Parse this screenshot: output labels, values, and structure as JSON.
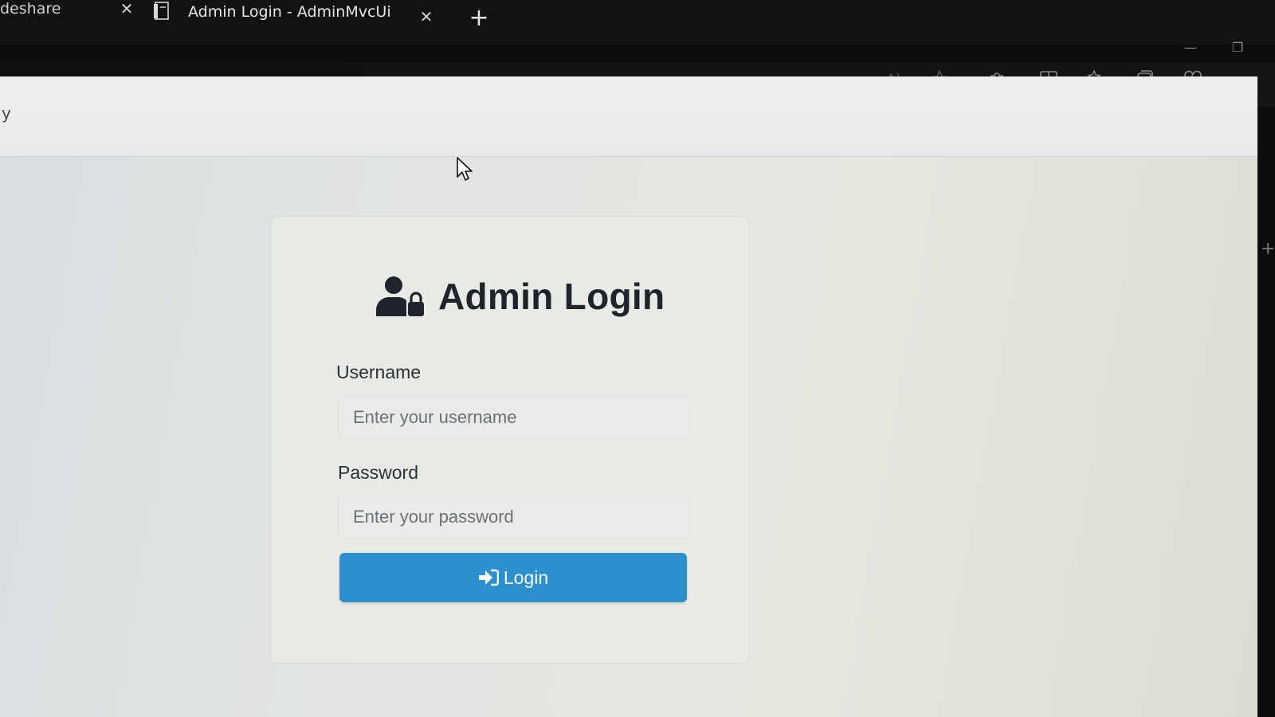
{
  "browser": {
    "tabs": [
      {
        "title": "deshare",
        "active": false
      },
      {
        "title": "Admin Login - AdminMvcUi",
        "active": true
      }
    ],
    "new_tab_symbol": "+",
    "close_symbol": "✕",
    "address_fragment": "y",
    "toolbar_icons": [
      "read-aloud-icon",
      "favorite-star-icon",
      "extensions-icon",
      "split-screen-icon",
      "favorites-list-icon",
      "collections-icon",
      "browser-essentials-icon",
      "more-menu-icon"
    ]
  },
  "login": {
    "title": "Admin Login",
    "heading_icon": "user-lock-icon",
    "username_label": "Username",
    "username_placeholder": "Enter your username",
    "password_label": "Password",
    "password_placeholder": "Enter your password",
    "button_label": "Login",
    "button_icon": "sign-in-icon"
  },
  "colors": {
    "primary_button": "#2d8fcd",
    "heading_text": "#1f242b",
    "page_background": "#e2e5e3"
  }
}
